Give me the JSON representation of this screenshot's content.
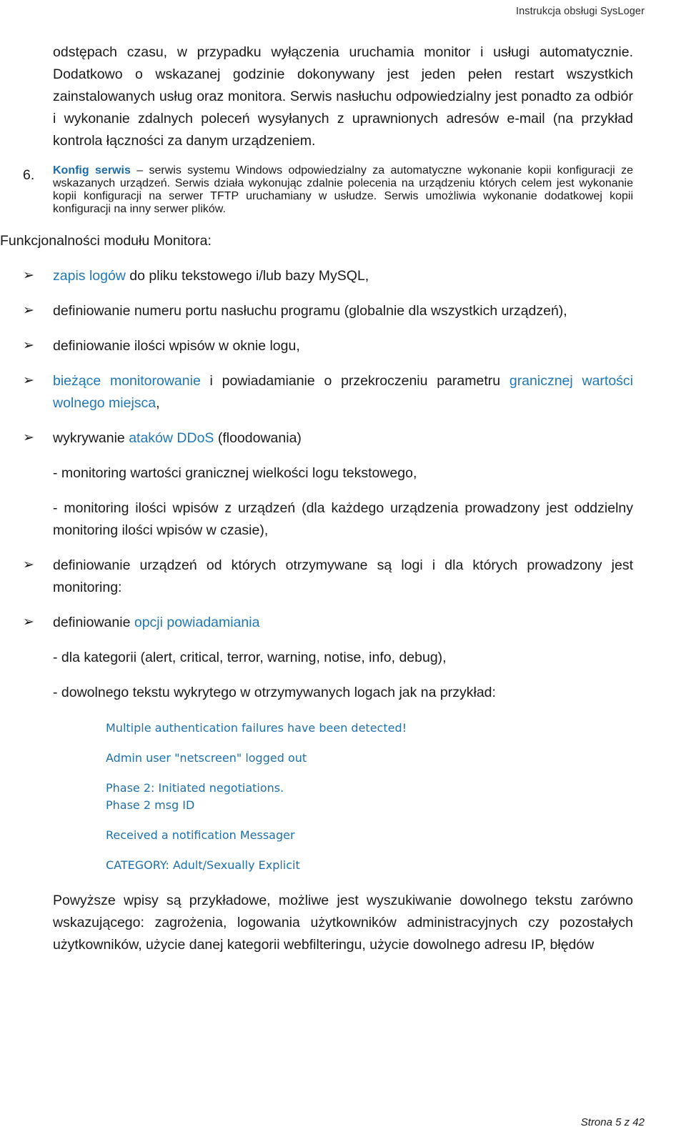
{
  "header": {
    "title": "Instrukcja obsługi SysLoger"
  },
  "footer": {
    "page_label": "Strona 5 z 42"
  },
  "colors": {
    "accent_blue": "#2277b8",
    "accent_blue_bold": "#1c6aa8",
    "example_blue": "#1f6fad",
    "body_text": "#1a1a1a",
    "page_background": "#ffffff"
  },
  "intro_paragraph": {
    "text": "odstępach czasu, w przypadku wyłączenia uruchamia monitor i usługi automatycznie. Dodatkowo o wskazanej godzinie dokonywany jest jeden pełen restart wszystkich zainstalowanych usług oraz monitora. Serwis nasłuchu odpowiedzialny jest ponadto za odbiór i wykonanie zdalnych poleceń wysyłanych z uprawnionych adresów e-mail (na przykład kontrola łączności za danym urządzeniem."
  },
  "numbered_item": {
    "number": "6.",
    "term": "Konfig serwis",
    "dash": " – ",
    "text": "serwis systemu Windows odpowiedzialny za automatyczne wykonanie kopii konfiguracji ze wskazanych urządzeń. Serwis działa wykonując zdalnie polecenia na urządzeniu których celem jest wykonanie kopii konfiguracji na serwer TFTP uruchamiany w usłudze. Serwis umożliwia wykonanie dodatkowej kopii konfiguracji na inny serwer plików."
  },
  "section_heading": {
    "text": "Funkcjonalności modułu Monitora:"
  },
  "bullet_marker": "arrow-bullet-icon",
  "bullets": [
    {
      "marker": "➢",
      "segments": [
        {
          "text": "zapis logów",
          "style": "accent"
        },
        {
          "text": " do pliku tekstowego i/lub bazy MySQL,",
          "style": "plain"
        }
      ]
    },
    {
      "marker": "➢",
      "segments": [
        {
          "text": "definiowanie numeru portu nasłuchu programu (globalnie dla wszystkich urządzeń),",
          "style": "plain"
        }
      ]
    },
    {
      "marker": "➢",
      "segments": [
        {
          "text": "definiowanie ilości wpisów w oknie logu,",
          "style": "plain"
        }
      ]
    },
    {
      "marker": "➢",
      "segments": [
        {
          "text": "bieżące monitorowanie",
          "style": "accent"
        },
        {
          "text": " i powiadamianie o przekroczeniu parametru ",
          "style": "plain"
        },
        {
          "text": "granicznej wartości wolnego miejsca",
          "style": "accent"
        },
        {
          "text": ",",
          "style": "plain"
        }
      ]
    },
    {
      "marker": "➢",
      "segments": [
        {
          "text": "wykrywanie ",
          "style": "plain"
        },
        {
          "text": "ataków DDoS",
          "style": "accent"
        },
        {
          "text": " (floodowania)",
          "style": "plain"
        }
      ]
    }
  ],
  "dash_items_group_1": [
    {
      "text": "- monitoring wartości granicznej wielkości logu tekstowego,"
    },
    {
      "text": "- monitoring ilości wpisów z urządzeń (dla każdego urządzenia prowadzony jest oddzielny monitoring ilości wpisów w czasie),"
    }
  ],
  "bullets_2": [
    {
      "marker": "➢",
      "segments": [
        {
          "text": "definiowanie urządzeń od których otrzymywane są logi i dla których prowadzony jest monitoring:",
          "style": "plain"
        }
      ]
    },
    {
      "marker": "➢",
      "segments": [
        {
          "text": "definiowanie ",
          "style": "plain"
        },
        {
          "text": "opcji powiadamiania",
          "style": "accent"
        }
      ]
    }
  ],
  "dash_items_group_2": [
    {
      "text": "- dla kategorii (alert, critical, terror, warning, notise, info, debug),"
    },
    {
      "text": "- dowolnego tekstu wykrytego w otrzymywanych logach jak na przykład:"
    }
  ],
  "examples": [
    {
      "text": "Multiple authentication failures have been detected!",
      "tight": false
    },
    {
      "text": "Admin user \"netscreen\" logged out",
      "tight": false
    },
    {
      "text": "Phase 2: Initiated negotiations.",
      "tight": true
    },
    {
      "text": "Phase 2 msg ID",
      "tight": false
    },
    {
      "text": "Received a notification Messager",
      "tight": false
    },
    {
      "text": "CATEGORY: Adult/Sexually Explicit",
      "tight": false
    }
  ],
  "closing_paragraph": {
    "text": "Powyższe wpisy są przykładowe, możliwe jest wyszukiwanie dowolnego tekstu zarówno wskazującego: zagrożenia, logowania użytkowników administracyjnych czy pozostałych użytkowników, użycie danej kategorii webfilteringu, użycie dowolnego adresu IP, błędów"
  }
}
